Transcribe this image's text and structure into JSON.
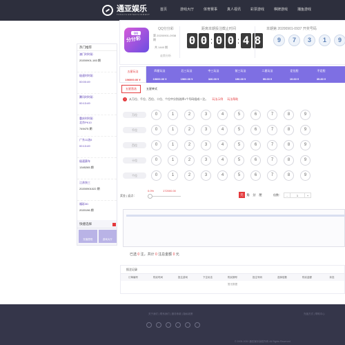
{
  "brand": {
    "name": "通亚娱乐",
    "sub": "TONGYA ENTERTAINMENT"
  },
  "nav": [
    "首页",
    "游戏大厅",
    "体育赛事",
    "真人视讯",
    "彩票游戏",
    "棋牌游戏",
    "捕鱼游戏"
  ],
  "sidebar": {
    "title": "热门推荐",
    "entries": [
      {
        "name": "澳门时时彩",
        "period": "20200901-183 期",
        "time": "00:03:49"
      },
      {
        "name": "极速时时彩",
        "period": "",
        "time": "00:00:49"
      },
      {
        "name": "腾讯时时彩",
        "period": "",
        "time": "00:13:49"
      },
      {
        "name": "重庆时时彩",
        "period": "749475 期",
        "time": "",
        "sublabel": "北京PK10",
        "sublabel_time": "00:13:49"
      },
      {
        "name": "广东11选5",
        "period": "",
        "time": "00:13:49"
      },
      {
        "name": "极速赛车",
        "period": "1345265 期",
        "time": "00:13:49"
      },
      {
        "name": "江苏快三",
        "period": "20200901022 期",
        "time": "00:13:49"
      },
      {
        "name": "福彩3D",
        "period": "2020196 期",
        "time": "04:43:49"
      },
      {
        "name": "新疆时时彩",
        "period": "",
        "time": "00:13:49"
      }
    ],
    "quick_label": "快捷选择",
    "buttons": [
      "充值提现",
      "游戏大厅"
    ]
  },
  "game": {
    "name": "QQ分分彩",
    "period": "第 20200901-0938 期",
    "count": "共 1440 期",
    "link": "走势分析",
    "badge": "QQ",
    "icon_text": "分分彩",
    "deadline_label": "距离本期投注截止时间",
    "countdown": [
      "0",
      "0",
      "0",
      "0",
      "4",
      "8"
    ],
    "result_label": "本期第 20200901-0937 开奖号码",
    "result_balls": [
      "9",
      "7",
      "3",
      "1",
      "9"
    ]
  },
  "play_tabs": [
    {
      "label": "五星玩法",
      "value": "196000.00 ¥",
      "active": true
    },
    {
      "label": "四星玩法",
      "value": "19600.00 ¥"
    },
    {
      "label": "后三玩法",
      "value": "1960.00 ¥"
    },
    {
      "label": "中三玩法",
      "value": "326.00 ¥"
    },
    {
      "label": "前三玩法",
      "value": "196.00 ¥"
    },
    {
      "label": "二星玩法",
      "value": "95.00 ¥"
    },
    {
      "label": "定位胆",
      "value": "19.60 ¥"
    },
    {
      "label": "不定胆",
      "value": "35.80 ¥"
    },
    {
      "label": "趣味",
      "value": "3.90 ¥"
    },
    {
      "label": "龙虎",
      "value": "4246.00 ¥"
    }
  ],
  "sub_tabs": [
    "五星直选",
    "五星单式"
  ],
  "rule": {
    "text": "从万位、千位、百位、十位、个位中分别选择1个号码组成一注。",
    "example": "玩法示例",
    "help": "玩法帮助"
  },
  "positions": [
    "万位",
    "千位",
    "百位",
    "十位",
    "个位"
  ],
  "numbers": [
    "0",
    "1",
    "2",
    "3",
    "4",
    "5",
    "6",
    "7",
    "8",
    "9"
  ],
  "rebate": {
    "label": "奖金 | 返点：",
    "percent": "0.0%",
    "amount": "172000.00",
    "units": [
      "元",
      "角",
      "分",
      "厘"
    ],
    "active_unit": "元",
    "multiplier_label": "倍数：",
    "multiplier_value": "1"
  },
  "summary": {
    "prefix": "已选",
    "count": "0",
    "mid": "注，共计",
    "amount": "0",
    "mid2": "注总金额",
    "money": "0",
    "suffix": "元"
  },
  "records": {
    "title": "投注记录",
    "columns": [
      "订单编号",
      "购买时间",
      "投注游戏",
      "下注玩法",
      "购买期号",
      "投注号码",
      "选择倍数",
      "购买金额",
      "状态"
    ],
    "empty": "暂无数据"
  },
  "footer": {
    "links": "关于我们  |  联系我们  |  服务条款  |  隐私政策",
    "right": "充值方式  |  帮助中心",
    "copy": "© 2005-2020 通亚娱乐版权所有 All Rights Reserved"
  },
  "colors": {
    "header": "#2d2f3d",
    "accent": "#7e6fe3",
    "red": "#e4393c",
    "footer": "#35364a"
  }
}
